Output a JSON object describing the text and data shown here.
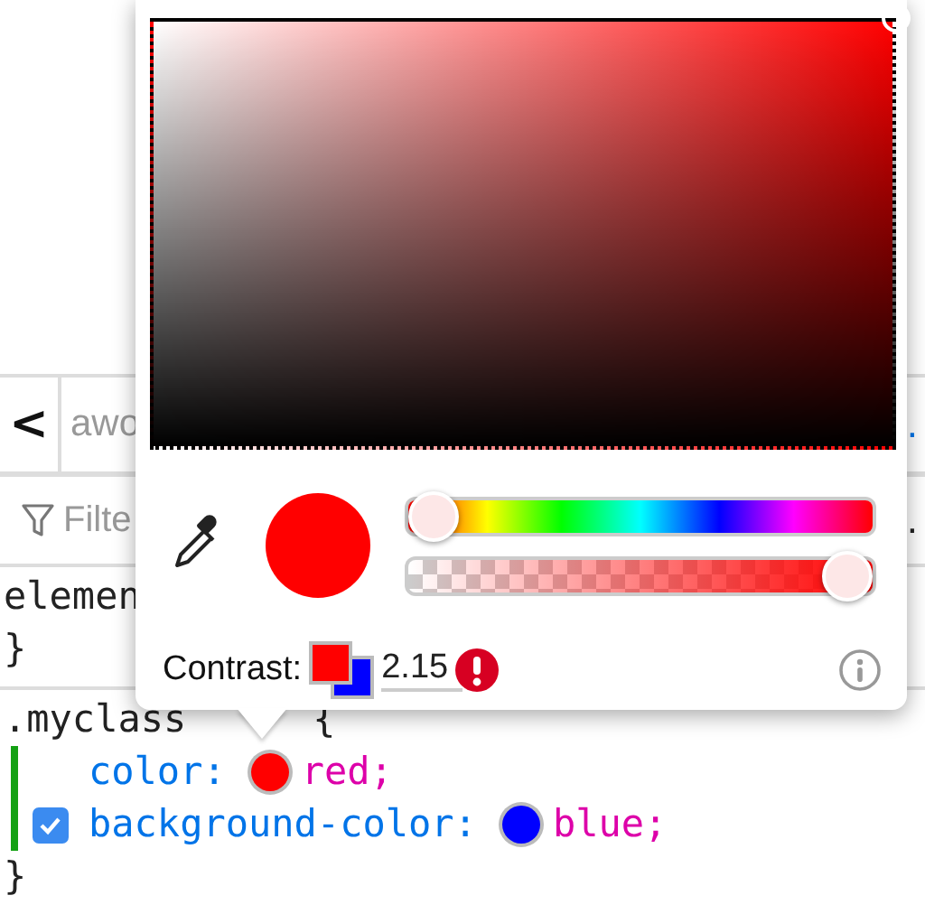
{
  "toolbar": {
    "back_button": "<",
    "tab_label": "awo",
    "right_text": "."
  },
  "filter": {
    "placeholder": "Filte",
    "right_text": "."
  },
  "rules": [
    {
      "selector": "elemen",
      "close_brace": "}"
    },
    {
      "selector": ".myclass",
      "open_brace": "{",
      "close_brace": "}",
      "declarations": [
        {
          "property": "color:",
          "value": "red;",
          "color": "#ff0000",
          "changed": true
        },
        {
          "property": "background-color:",
          "value": "blue;",
          "color": "#0000ff",
          "checked": true,
          "changed": true
        }
      ]
    }
  ],
  "picker": {
    "color": "#ff0000",
    "sliders": [
      {
        "kind": "hue",
        "level": 0
      },
      {
        "kind": "alpha",
        "level": 1
      }
    ],
    "contrast": {
      "label": "Contrast:",
      "value": "2.15",
      "swatches": [
        {
          "color": "#0000ff"
        },
        {
          "color": "#ff0000"
        }
      ],
      "warning": true
    }
  }
}
